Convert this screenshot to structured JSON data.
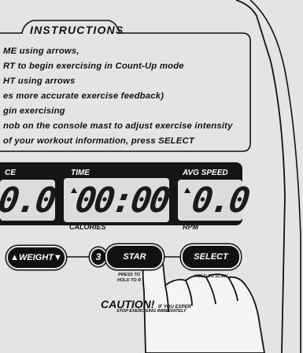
{
  "instructions": {
    "title": "INSTRUCTIONS",
    "lines": [
      "ME using arrows,",
      "RT to begin exercising in Count-Up mode",
      "HT using arrows",
      "es more accurate exercise feedback)",
      "gin exercising",
      "nob on the console mast to adjust exercise intensity",
      "of your workout information, press SELECT"
    ]
  },
  "display": {
    "left": {
      "label": "CE",
      "value": "0.0"
    },
    "center": {
      "label": "TIME",
      "value": "00:00",
      "sub_label": "CALORIES"
    },
    "right": {
      "label": "AVG SPEED",
      "value": "0.0",
      "sub_label": "RPM"
    }
  },
  "buttons": {
    "weight": "WEIGHT",
    "step_number": "3",
    "start": "STAR",
    "start_hint_1": "PRESS TO",
    "start_hint_2": "HOLD TO R",
    "select": "SELECT",
    "select_hint": "HOLD TO SCAN"
  },
  "caution": {
    "title": "CAUTION!",
    "line1": "IF YOU EXPER",
    "line2": "STOP EXERCISING IMMEDIATELY"
  },
  "icons": [
    "up-triangle-icon",
    "down-triangle-icon",
    "hand-icon"
  ]
}
